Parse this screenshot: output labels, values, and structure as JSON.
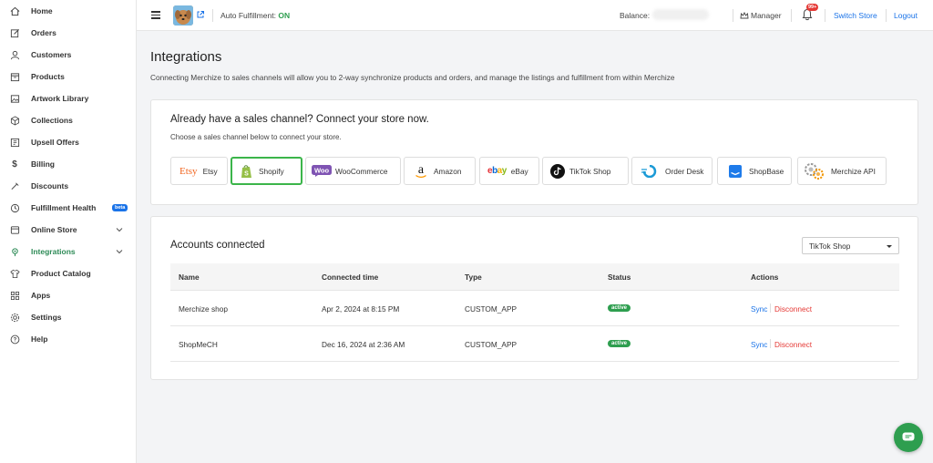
{
  "sidebar": {
    "items": [
      {
        "label": "Home",
        "icon": "home-icon"
      },
      {
        "label": "Orders",
        "icon": "edit-icon"
      },
      {
        "label": "Customers",
        "icon": "user-icon"
      },
      {
        "label": "Products",
        "icon": "box-icon"
      },
      {
        "label": "Artwork Library",
        "icon": "image-icon"
      },
      {
        "label": "Collections",
        "icon": "collection-icon"
      },
      {
        "label": "Upsell Offers",
        "icon": "upsell-icon"
      },
      {
        "label": "Billing",
        "icon": "dollar-icon"
      },
      {
        "label": "Discounts",
        "icon": "tag-icon"
      },
      {
        "label": "Fulfillment Health",
        "icon": "health-icon",
        "badge": "beta"
      },
      {
        "label": "Online Store",
        "icon": "store-icon",
        "expandable": true
      },
      {
        "label": "Integrations",
        "icon": "integrations-icon",
        "expandable": true,
        "active": true
      },
      {
        "label": "Product Catalog",
        "icon": "shirt-icon"
      },
      {
        "label": "Apps",
        "icon": "apps-icon"
      },
      {
        "label": "Settings",
        "icon": "gear-icon"
      },
      {
        "label": "Help",
        "icon": "help-icon"
      }
    ]
  },
  "header": {
    "auto_fulfillment_label": "Auto Fulfillment:",
    "auto_fulfillment_value": "ON",
    "balance_label": "Balance:",
    "manager_label": "Manager",
    "notification_count": "99+",
    "switch_store_label": "Switch Store",
    "logout_label": "Logout"
  },
  "page": {
    "title": "Integrations",
    "description": "Connecting Merchize to sales channels will allow you to 2-way synchronize products and orders, and manage the listings and fulfillment from within Merchize"
  },
  "connect": {
    "title": "Already have a sales channel? Connect your store now.",
    "subtitle": "Choose a sales channel below to connect your store.",
    "channels": [
      {
        "name": "Etsy",
        "icon": "etsy-icon"
      },
      {
        "name": "Shopify",
        "icon": "shopify-icon",
        "selected": true
      },
      {
        "name": "WooCommerce",
        "icon": "woocommerce-icon"
      },
      {
        "name": "Amazon",
        "icon": "amazon-icon"
      },
      {
        "name": "eBay",
        "icon": "ebay-icon"
      },
      {
        "name": "TikTok Shop",
        "icon": "tiktok-icon"
      },
      {
        "name": "Order Desk",
        "icon": "orderdesk-icon"
      },
      {
        "name": "ShopBase",
        "icon": "shopbase-icon"
      },
      {
        "name": "Merchize API",
        "icon": "api-icon"
      }
    ]
  },
  "accounts": {
    "title": "Accounts connected",
    "filter_value": "TikTok Shop",
    "columns": [
      "Name",
      "Connected time",
      "Type",
      "Status",
      "Actions"
    ],
    "rows": [
      {
        "name": "Merchize shop",
        "connected": "Apr 2, 2024 at 8:15 PM",
        "type": "CUSTOM_APP",
        "status": "active",
        "sync": "Sync",
        "disconnect": "Disconnect"
      },
      {
        "name": "ShopMeCH",
        "connected": "Dec 16, 2024 at 2:36 AM",
        "type": "CUSTOM_APP",
        "status": "active",
        "sync": "Sync",
        "disconnect": "Disconnect"
      }
    ]
  },
  "colors": {
    "accent_green": "#2e9e4f",
    "link_blue": "#1a73e8",
    "danger_red": "#e53935"
  }
}
